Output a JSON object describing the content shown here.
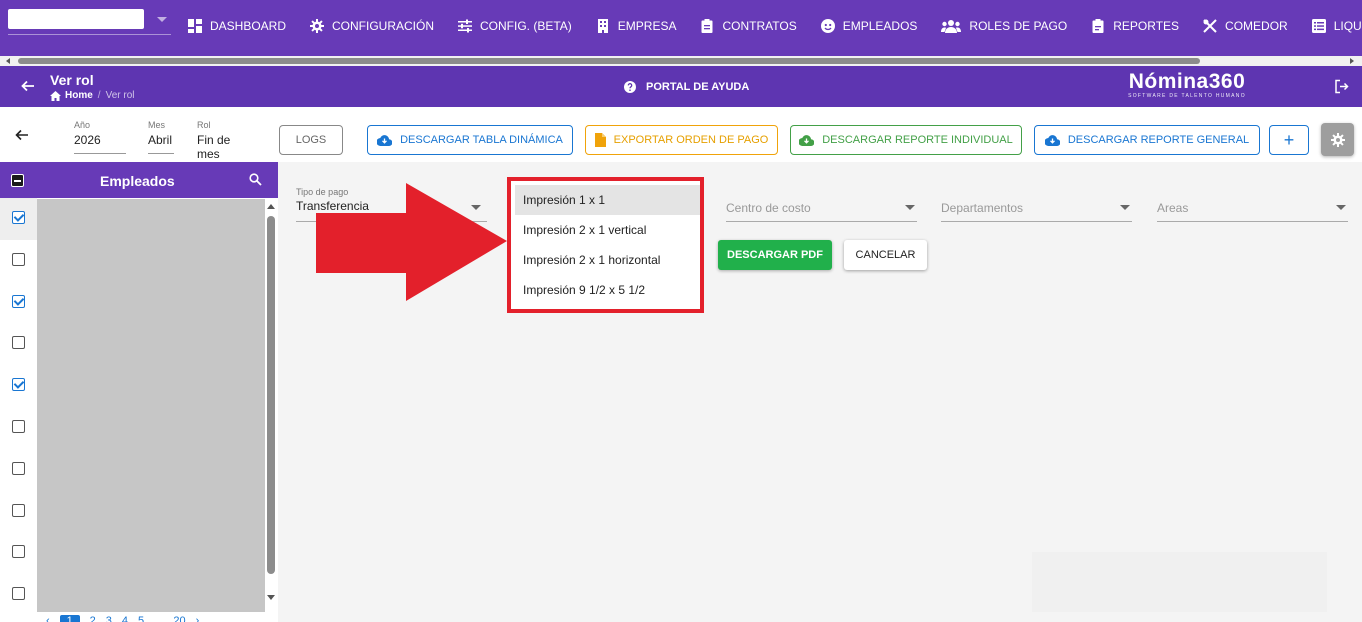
{
  "nav": {
    "items": [
      {
        "label": "DASHBOARD",
        "icon": "dashboard-icon"
      },
      {
        "label": "CONFIGURACIÓN",
        "icon": "gear-icon"
      },
      {
        "label": "CONFIG. (BETA)",
        "icon": "sliders-icon"
      },
      {
        "label": "EMPRESA",
        "icon": "building-icon"
      },
      {
        "label": "CONTRATOS",
        "icon": "clipboard-icon"
      },
      {
        "label": "EMPLEADOS",
        "icon": "face-icon"
      },
      {
        "label": "ROLES DE PAGO",
        "icon": "users-icon"
      },
      {
        "label": "REPORTES",
        "icon": "report-icon"
      },
      {
        "label": "COMEDOR",
        "icon": "utensils-icon"
      },
      {
        "label": "LIQUIDACIONES",
        "icon": "list-icon"
      }
    ]
  },
  "header": {
    "title": "Ver rol",
    "breadcrumb_home": "Home",
    "breadcrumb_sep": "/",
    "breadcrumb_current": "Ver rol",
    "help": "PORTAL DE AYUDA",
    "brand_name": "Nómina360",
    "brand_tagline": "SOFTWARE DE TALENTO HUMANO"
  },
  "filters": {
    "year_label": "Año",
    "year_value": "2026",
    "month_label": "Mes",
    "month_value": "Abril",
    "rol_label": "Rol",
    "rol_value": "Fin de mes"
  },
  "toolbar": {
    "logs": "LOGS",
    "tabla": "DESCARGAR TABLA DINÁMICA",
    "orden": "EXPORTAR ORDEN DE PAGO",
    "individual": "DESCARGAR REPORTE INDIVIDUAL",
    "general": "DESCARGAR REPORTE GENERAL",
    "plus": "+"
  },
  "sidebar": {
    "title": "Empleados",
    "checks": [
      true,
      false,
      true,
      false,
      true,
      false,
      false,
      false,
      false,
      false
    ],
    "pages": [
      "‹",
      "1",
      "2",
      "3",
      "4",
      "5",
      "...",
      "20",
      "›"
    ],
    "active_page": "1"
  },
  "form": {
    "tipo_label": "Tipo de pago",
    "tipo_value": "Transferencia",
    "centro": "Centro de costo",
    "departamentos": "Departamentos",
    "areas": "Areas"
  },
  "dropdown": {
    "options": [
      "Impresión 1 x 1",
      "Impresión 2 x 1 vertical",
      "Impresión 2 x 1 horizontal",
      "Impresión 9 1/2 x 5 1/2"
    ],
    "highlighted": 0
  },
  "actions": {
    "pdf": "DESCARGAR PDF",
    "cancel": "CANCELAR"
  },
  "colors": {
    "nav": "#673ab7",
    "header": "#5e35b1",
    "highlight_box": "#e3202b",
    "primary": "#1976d2",
    "success": "#21b04b",
    "warning": "#f0a30a"
  }
}
